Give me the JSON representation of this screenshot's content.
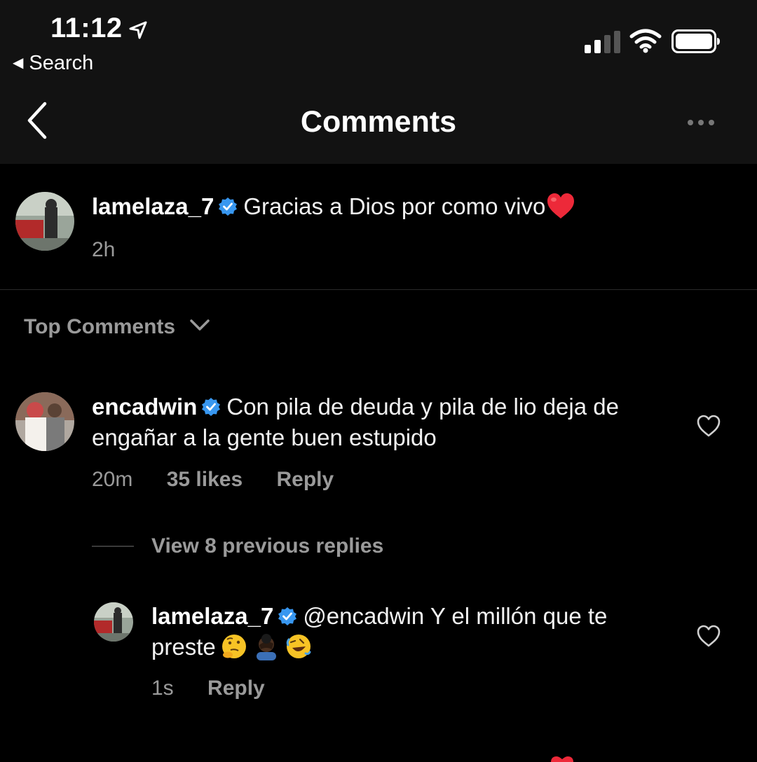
{
  "status_bar": {
    "time": "11:12",
    "back_app": "Search",
    "icons": [
      "location-arrow-icon",
      "cellular-signal-icon",
      "wifi-icon",
      "battery-icon"
    ]
  },
  "header": {
    "title": "Comments",
    "back_icon": "chevron-left-icon",
    "more_icon": "more-dots-icon"
  },
  "caption": {
    "username": "lamelaza_7",
    "verified": true,
    "text": "Gracias a Dios por como vivo",
    "emoji": "red-heart",
    "time": "2h"
  },
  "section": {
    "label": "Top Comments"
  },
  "comments": [
    {
      "username": "encadwin",
      "verified": true,
      "text": "Con pila de deuda y pila de lio deja de engañar a la gente buen estupido",
      "time": "20m",
      "likes": "35 likes",
      "reply_label": "Reply",
      "view_replies": "View 8 previous replies",
      "replies": [
        {
          "username": "lamelaza_7",
          "verified": true,
          "text": "@encadwin Y el millón que te preste",
          "emojis": [
            "thinking-face",
            "facepalm",
            "rolling-on-floor-laughing"
          ],
          "time": "1s",
          "reply_label": "Reply"
        }
      ]
    }
  ],
  "colors": {
    "background": "#000000",
    "header_bg": "#121212",
    "verified_blue": "#3897f0",
    "meta_gray": "#9a9a9a",
    "heart_red": "#ed2939"
  }
}
